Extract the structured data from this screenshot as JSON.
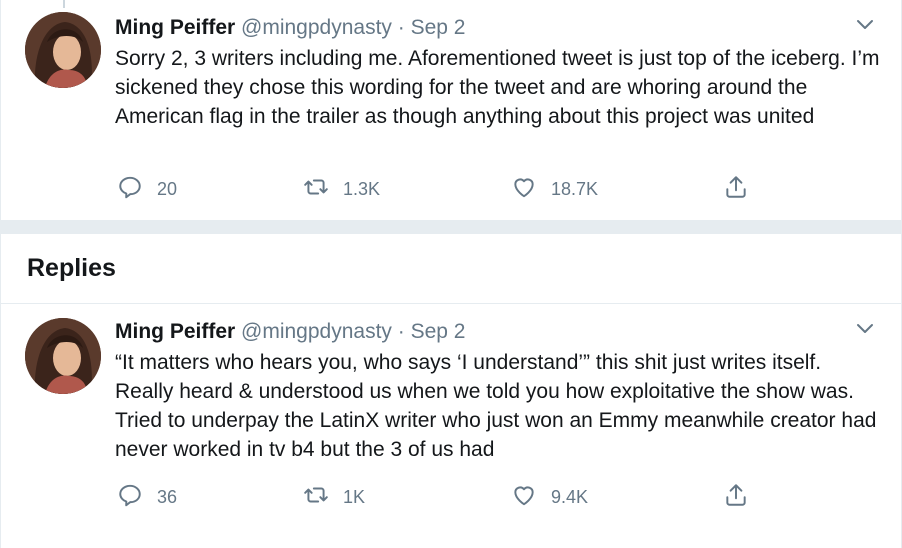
{
  "tweets": [
    {
      "name": "Ming Peiffer",
      "handle": "@mingpdynasty",
      "separator": "·",
      "date": "Sep 2",
      "text": "Sorry 2, 3 writers including me. Aforementioned tweet is just top of the iceberg. I’m sickened they chose this wording for the tweet and are whoring around the American flag in the trailer as though anything about this project was united",
      "replies": "20",
      "retweets": "1.3K",
      "likes": "18.7K"
    },
    {
      "name": "Ming Peiffer",
      "handle": "@mingpdynasty",
      "separator": "·",
      "date": "Sep 2",
      "text": "“It matters who hears you, who says ‘I understand’” this shit just writes itself. Really heard & understood us when we told you how exploitative the show was. Tried to underpay the LatinX writer who just won an Emmy meanwhile creator had never worked in tv b4 but the 3 of us had",
      "replies": "36",
      "retweets": "1K",
      "likes": "9.4K"
    }
  ],
  "section": {
    "replies_title": "Replies"
  },
  "icons": {
    "reply": "reply-icon",
    "retweet": "retweet-icon",
    "like": "heart-icon",
    "share": "share-icon",
    "caret": "chevron-down-icon"
  },
  "colors": {
    "text": "#14171a",
    "muted": "#657786",
    "divider": "#e6ecf0"
  }
}
